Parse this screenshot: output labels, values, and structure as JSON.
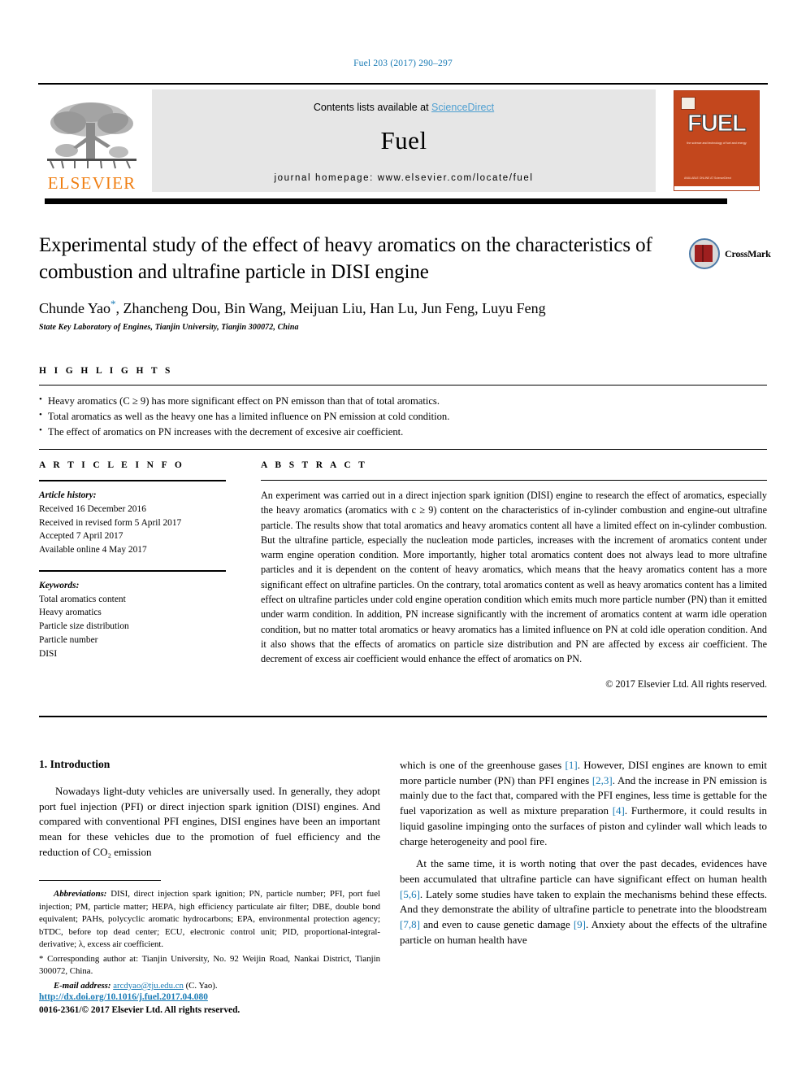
{
  "running_head": "Fuel 203 (2017) 290–297",
  "masthead": {
    "publisher_name": "ELSEVIER",
    "contents_prefix": "Contents lists available at ",
    "contents_link": "ScienceDirect",
    "journal_name": "Fuel",
    "homepage": "journal homepage: www.elsevier.com/locate/fuel",
    "cover": {
      "title": "FUEL",
      "subtitle": "the science and technology of fuel and energy",
      "footer": "AVAILABLE ONLINE AT\nScienceDirect"
    },
    "link_color": "#4e9fd1",
    "elsevier_orange": "#f07f13"
  },
  "article": {
    "title": "Experimental study of the effect of heavy aromatics on the characteristics of combustion and ultrafine particle in DISI engine",
    "authors": "Chunde Yao",
    "authors_rest": ", Zhancheng Dou, Bin Wang, Meijuan Liu, Han Lu, Jun Feng, Luyu Feng",
    "corresponding_marker": "*",
    "affiliation": "State Key Laboratory of Engines, Tianjin University, Tianjin 300072, China",
    "crossmark_label": "CrossMark"
  },
  "highlights": {
    "label": "H I G H L I G H T S",
    "items": [
      "Heavy aromatics (C ≥ 9) has more significant effect on PN emisson than that of total aromatics.",
      "Total aromatics as well as the heavy one has a limited influence on PN emission at cold condition.",
      "The effect of aromatics on PN increases with the decrement of excesive air coefficient."
    ]
  },
  "article_info": {
    "label": "A R T I C L E   I N F O",
    "history_head": "Article history:",
    "history": [
      "Received 16 December 2016",
      "Received in revised form 5 April 2017",
      "Accepted 7 April 2017",
      "Available online 4 May 2017"
    ],
    "keywords_head": "Keywords:",
    "keywords": [
      "Total aromatics content",
      "Heavy aromatics",
      "Particle size distribution",
      "Particle number",
      "DISI"
    ]
  },
  "abstract": {
    "label": "A B S T R A C T",
    "text": "An experiment was carried out in a direct injection spark ignition (DISI) engine to research the effect of aromatics, especially the heavy aromatics (aromatics with c ≥ 9) content on the characteristics of in-cylinder combustion and engine-out ultrafine particle. The results show that total aromatics and heavy aromatics content all have a limited effect on in-cylinder combustion. But the ultrafine particle, especially the nucleation mode particles, increases with the increment of aromatics content under warm engine operation condition. More importantly, higher total aromatics content does not always lead to more ultrafine particles and it is dependent on the content of heavy aromatics, which means that the heavy aromatics content has a more significant effect on ultrafine particles. On the contrary, total aromatics content as well as heavy aromatics content has a limited effect on ultrafine particles under cold engine operation condition which emits much more particle number (PN) than it emitted under warm condition. In addition, PN increase significantly with the increment of aromatics content at warm idle operation condition, but no matter total aromatics or heavy aromatics has a limited influence on PN at cold idle operation condition. And it also shows that the effects of aromatics on particle size distribution and PN are affected by excess air coefficient. The decrement of excess air coefficient would enhance the effect of aromatics on PN.",
    "copyright": "© 2017 Elsevier Ltd. All rights reserved."
  },
  "body": {
    "section_number_title": "1. Introduction",
    "left_paragraph_1": "Nowadays light-duty vehicles are universally used. In generally, they adopt port fuel injection (PFI) or direct injection spark ignition (DISI) engines. And compared with conventional PFI engines, DISI engines have been an important mean for these vehicles due to the promotion of fuel efficiency and the reduction of CO₂ emission",
    "right_paragraph_1_a": "which is one of the greenhouse gases ",
    "right_ref_1": "[1]",
    "right_paragraph_1_b": ". However, DISI engines are known to emit more particle number (PN) than PFI engines ",
    "right_ref_2": "[2,3]",
    "right_paragraph_1_c": ". And the increase in PN emission is mainly due to the fact that, compared with the PFI engines, less time is gettable for the fuel vaporization as well as mixture preparation ",
    "right_ref_3": "[4]",
    "right_paragraph_1_d": ". Furthermore, it could results in liquid gasoline impinging onto the surfaces of piston and cylinder wall which leads to charge heterogeneity and pool fire.",
    "right_paragraph_2_a": "At the same time, it is worth noting that over the past decades, evidences have been accumulated that ultrafine particle can have significant effect on human health ",
    "right_ref_4": "[5,6]",
    "right_paragraph_2_b": ". Lately some studies have taken to explain the mechanisms behind these effects. And they demonstrate the ability of ultrafine particle to penetrate into the bloodstream ",
    "right_ref_5": "[7,8]",
    "right_paragraph_2_c": " and even to cause genetic damage ",
    "right_ref_6": "[9]",
    "right_paragraph_2_d": ". Anxiety about the effects of the ultrafine particle on human health have"
  },
  "footnotes": {
    "abbrev_head": "Abbreviations:",
    "abbrev_text": " DISI, direct injection spark ignition; PN, particle number; PFI, port fuel injection; PM, particle matter; HEPA, high efficiency particulate air filter; DBE, double bond equivalent; PAHs, polycyclic aromatic hydrocarbons; EPA, environmental protection agency; bTDC, before top dead center; ECU, electronic control unit; PID, proportional-integral-derivative; λ, excess air coefficient.",
    "corresponding": "* Corresponding author at: Tianjin University, No. 92 Weijin Road, Nankai District, Tianjin 300072, China.",
    "email_head": "E-mail address:",
    "email_link": "arcdyao@tju.edu.cn",
    "email_tail": " (C. Yao)."
  },
  "doi": {
    "url": "http://dx.doi.org/10.1016/j.fuel.2017.04.080",
    "issn_line": "0016-2361/© 2017 Elsevier Ltd. All rights reserved."
  }
}
